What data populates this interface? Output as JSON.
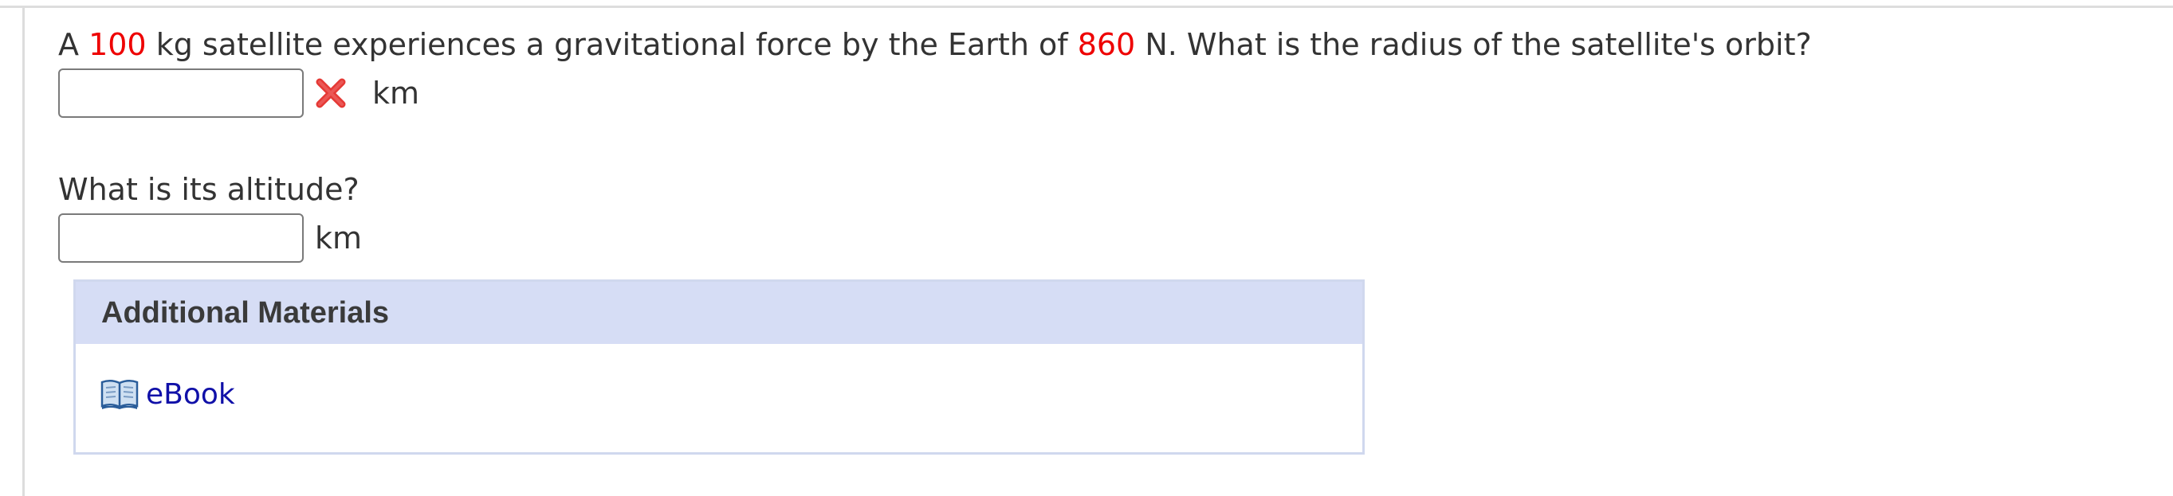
{
  "question1": {
    "prefix": "A ",
    "mass_value": "100",
    "middle": " kg satellite experiences a gravitational force by the Earth of ",
    "force_value": "860",
    "suffix": " N. What is the radius of the satellite's orbit?",
    "input_value": "",
    "unit": "km",
    "status_icon": "x-mark-icon",
    "status_color": "#e53935"
  },
  "question2": {
    "text": "What is its altitude?",
    "input_value": "",
    "unit": "km"
  },
  "additional_materials": {
    "title": "Additional Materials",
    "links": [
      {
        "label": "eBook",
        "icon": "book-icon"
      }
    ]
  },
  "colors": {
    "highlight": "#ee0000",
    "link": "#1010a8",
    "panel_header_bg": "#d6ddf5"
  }
}
